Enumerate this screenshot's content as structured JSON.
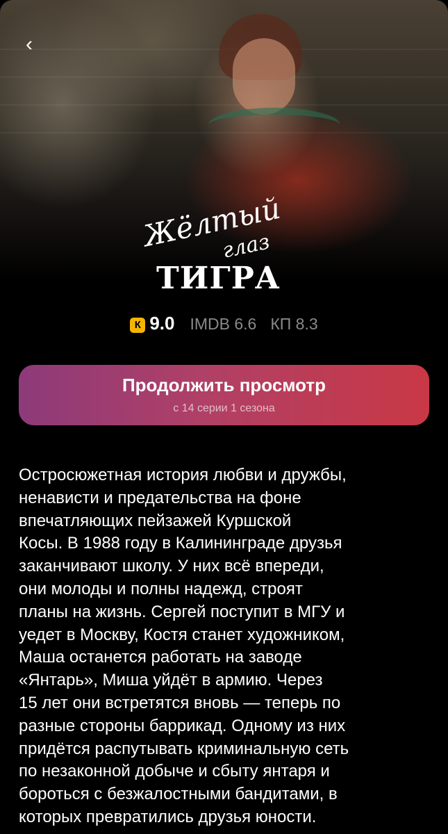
{
  "header": {
    "back_icon": "chevron-left-icon",
    "back_glyph": "‹"
  },
  "title_logo": {
    "script_line1": "Жёлтый",
    "script_line2": "глаз",
    "block_line": "ТИГРА"
  },
  "ratings": {
    "badge_letter": "К",
    "badge_color": "#f5b400",
    "main_rating": "9.0",
    "imdb": "IMDB 6.6",
    "kp": "КП 8.3"
  },
  "continue_button": {
    "label": "Продолжить просмотр",
    "sublabel": "с 14 серии 1 сезона",
    "gradient_start": "#8d3a7a",
    "gradient_end": "#c93845"
  },
  "description": {
    "lines": [
      "Остросюжетная история любви и дружбы,",
      "ненависти и предательства на фоне",
      "впечатляющих пейзажей Куршской",
      "Косы. В 1988 году в Калининграде друзья",
      "заканчивают школу. У них всё впереди,",
      "они молоды и полны надежд, строят",
      "планы на жизнь. Сергей поступит в МГУ и",
      "уедет в Москву, Костя станет художником,",
      "Маша останется работать на заводе",
      "«Янтарь», Миша уйдёт в армию. Через",
      "15 лет они встретятся вновь — теперь по",
      "разные стороны баррикад. Одному из них",
      "придётся распутывать криминальную сеть",
      "по незаконной добыче и сбыту янтаря и",
      "бороться с безжалостными бандитами, в",
      "которых превратились друзья юности."
    ]
  }
}
